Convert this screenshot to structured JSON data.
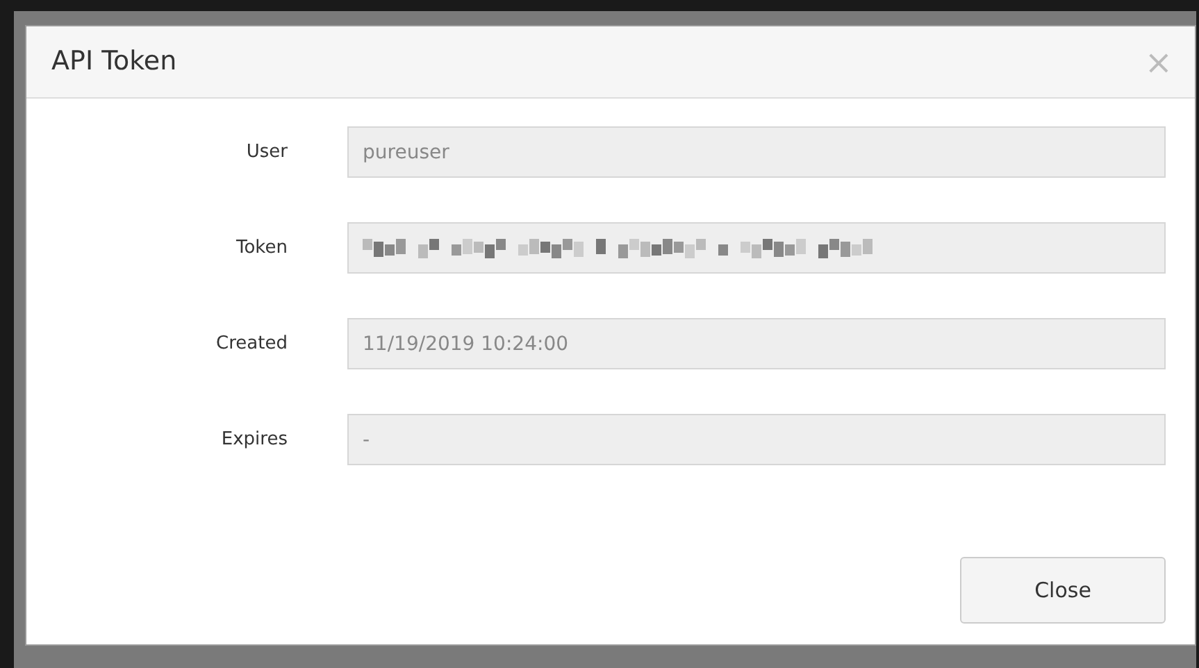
{
  "dialog": {
    "title": "API Token",
    "close_symbol": "×",
    "fields": [
      {
        "label": "User",
        "kind": "text",
        "value": "pureuser"
      },
      {
        "label": "Token",
        "kind": "redacted"
      },
      {
        "label": "Created",
        "kind": "text",
        "value": "11/19/2019 10:24:00"
      },
      {
        "label": "Expires",
        "kind": "text",
        "value": "-"
      }
    ],
    "buttons": [
      "Close"
    ]
  }
}
